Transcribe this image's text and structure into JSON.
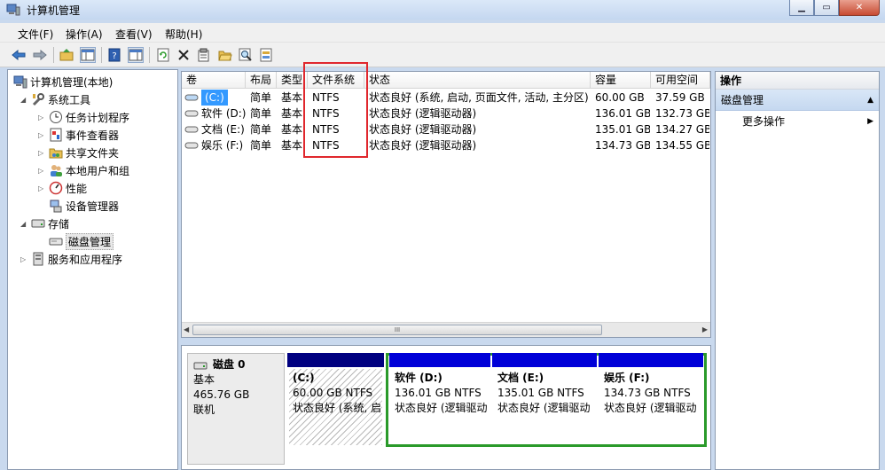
{
  "window": {
    "title": "计算机管理",
    "buttons": [
      "min",
      "max",
      "close"
    ]
  },
  "menu": [
    "文件(F)",
    "操作(A)",
    "查看(V)",
    "帮助(H)"
  ],
  "toolbar_icons": [
    "back-arrow-icon",
    "forward-arrow-icon",
    "up-folder-icon",
    "console-tree-icon",
    "help-icon",
    "show-hide-pane-icon",
    "refresh-icon",
    "delete-icon",
    "properties-icon",
    "open-folder-icon",
    "search-icon",
    "export-icon"
  ],
  "tree": [
    {
      "label": "计算机管理(本地)",
      "level": 0,
      "expander": "",
      "icon": "computer-icon"
    },
    {
      "label": "系统工具",
      "level": 1,
      "expander": "open",
      "icon": "tools-icon"
    },
    {
      "label": "任务计划程序",
      "level": 2,
      "expander": "closed",
      "icon": "clock-icon"
    },
    {
      "label": "事件查看器",
      "level": 2,
      "expander": "closed",
      "icon": "event-viewer-icon"
    },
    {
      "label": "共享文件夹",
      "level": 2,
      "expander": "closed",
      "icon": "shared-folder-icon"
    },
    {
      "label": "本地用户和组",
      "level": 2,
      "expander": "closed",
      "icon": "users-icon"
    },
    {
      "label": "性能",
      "level": 2,
      "expander": "closed",
      "icon": "performance-icon"
    },
    {
      "label": "设备管理器",
      "level": 2,
      "expander": "",
      "icon": "device-manager-icon"
    },
    {
      "label": "存储",
      "level": 1,
      "expander": "open",
      "icon": "storage-icon"
    },
    {
      "label": "磁盘管理",
      "level": 2,
      "expander": "",
      "icon": "disk-icon",
      "selected": true
    },
    {
      "label": "服务和应用程序",
      "level": 1,
      "expander": "closed",
      "icon": "services-icon"
    }
  ],
  "volume_table": {
    "columns": [
      "卷",
      "布局",
      "类型",
      "文件系统",
      "状态",
      "容量",
      "可用空间"
    ],
    "rows": [
      [
        "(C:)",
        "简单",
        "基本",
        "NTFS",
        "状态良好 (系统, 启动, 页面文件, 活动, 主分区)",
        "60.00 GB",
        "37.59 GB"
      ],
      [
        "软件 (D:)",
        "简单",
        "基本",
        "NTFS",
        "状态良好 (逻辑驱动器)",
        "136.01 GB",
        "132.73 GB"
      ],
      [
        "文档 (E:)",
        "简单",
        "基本",
        "NTFS",
        "状态良好 (逻辑驱动器)",
        "135.01 GB",
        "134.27 GB"
      ],
      [
        "娱乐 (F:)",
        "简单",
        "基本",
        "NTFS",
        "状态良好 (逻辑驱动器)",
        "134.73 GB",
        "134.55 GB"
      ]
    ],
    "scroll_grip": "III"
  },
  "disk": {
    "name": "磁盘 0",
    "type": "基本",
    "size": "465.76 GB",
    "status": "联机",
    "partitions": [
      {
        "name": "(C:)",
        "size": "60.00 GB NTFS",
        "status": "状态良好 (系统, 启"
      },
      {
        "name": "软件 (D:)",
        "size": "136.01 GB NTFS",
        "status": "状态良好 (逻辑驱动"
      },
      {
        "name": "文档 (E:)",
        "size": "135.01 GB NTFS",
        "status": "状态良好 (逻辑驱动"
      },
      {
        "name": "娱乐 (F:)",
        "size": "134.73 GB NTFS",
        "status": "状态良好 (逻辑驱动"
      }
    ]
  },
  "actions": {
    "header": "操作",
    "section": "磁盘管理",
    "item": "更多操作"
  },
  "colors": {
    "primary_partition": "#000080",
    "logical_partition": "#0000d8",
    "extended_border": "#2a9a2a",
    "highlight_box": "#e0272d"
  }
}
